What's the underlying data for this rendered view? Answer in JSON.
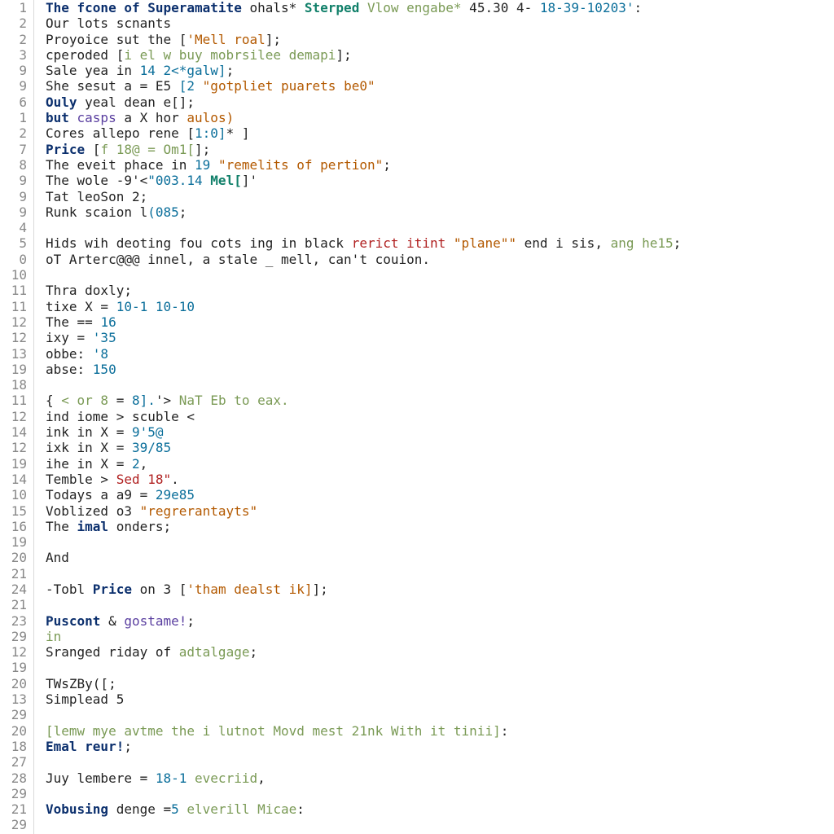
{
  "gutter_numbers": [
    "1",
    "2",
    "2",
    "3",
    "9",
    "9",
    "6",
    "1",
    "2",
    "7",
    "8",
    "9",
    "9",
    "9",
    "4",
    "5",
    "0",
    "10",
    "11",
    "11",
    "12",
    "12",
    "13",
    "19",
    "18",
    "11",
    "12",
    "14",
    "12",
    "19",
    "14",
    "10",
    "15",
    "16",
    "19",
    "20",
    "21",
    "24",
    "21",
    "23",
    "29",
    "12",
    "19",
    "20",
    "13",
    "29",
    "20",
    "18",
    "27",
    "28",
    "29",
    "21",
    "29"
  ],
  "lines": [
    [
      {
        "cls": "kw",
        "t": "The fcone of Superamatite"
      },
      {
        "cls": "pl",
        "t": " ohals* "
      },
      {
        "cls": "ty",
        "t": "Sterped "
      },
      {
        "cls": "com",
        "t": "Vlow engabe*"
      },
      {
        "cls": "pl",
        "t": " 45.30 4- "
      },
      {
        "cls": "num",
        "t": "18-39-10203'"
      },
      {
        "cls": "pl",
        "t": ":"
      }
    ],
    [
      {
        "cls": "pl",
        "t": "Our lots scnants"
      }
    ],
    [
      {
        "cls": "pl",
        "t": "Proyoice sut the ["
      },
      {
        "cls": "str",
        "t": "'Mell roal"
      },
      {
        "cls": "pl",
        "t": "];"
      }
    ],
    [
      {
        "cls": "pl",
        "t": "cperoded ["
      },
      {
        "cls": "com",
        "t": "i el w buy mobrsilee demapi"
      },
      {
        "cls": "pl",
        "t": "];"
      }
    ],
    [
      {
        "cls": "pl",
        "t": "Sale yea in "
      },
      {
        "cls": "num",
        "t": "14 2<*galw]"
      },
      {
        "cls": "pl",
        "t": ";"
      }
    ],
    [
      {
        "cls": "pl",
        "t": "She sesut a = E5 "
      },
      {
        "cls": "num",
        "t": "[2 "
      },
      {
        "cls": "str",
        "t": "\"gotpliet puarets be0\""
      }
    ],
    [
      {
        "cls": "kw",
        "t": "Ouly"
      },
      {
        "cls": "pl",
        "t": " yeal dean e[];"
      }
    ],
    [
      {
        "cls": "kw",
        "t": "but "
      },
      {
        "cls": "fn",
        "t": "casps"
      },
      {
        "cls": "pl",
        "t": " a X hor "
      },
      {
        "cls": "str",
        "t": "aulos)"
      }
    ],
    [
      {
        "cls": "pl",
        "t": "Cores allepo rene ["
      },
      {
        "cls": "num",
        "t": "1:0]"
      },
      {
        "cls": "pl",
        "t": "* ]"
      }
    ],
    [
      {
        "cls": "kw",
        "t": "Price"
      },
      {
        "cls": "pl",
        "t": " ["
      },
      {
        "cls": "com",
        "t": "f 18@ = Om1["
      },
      {
        "cls": "pl",
        "t": "];"
      }
    ],
    [
      {
        "cls": "pl",
        "t": "The eveit phace in "
      },
      {
        "cls": "num",
        "t": "19 "
      },
      {
        "cls": "str",
        "t": "\"remelits of pertion\""
      },
      {
        "cls": "pl",
        "t": ";"
      }
    ],
    [
      {
        "cls": "pl",
        "t": "The wole -9'<"
      },
      {
        "cls": "num",
        "t": "\"003.14 "
      },
      {
        "cls": "ty",
        "t": "Mel["
      },
      {
        "cls": "pl",
        "t": "]'"
      }
    ],
    [
      {
        "cls": "pl",
        "t": "Tat leoSon 2;"
      }
    ],
    [
      {
        "cls": "pl",
        "t": "Runk scaion l"
      },
      {
        "cls": "num",
        "t": "(085"
      },
      {
        "cls": "pl",
        "t": ";"
      }
    ],
    [
      {
        "cls": "pl",
        "t": ""
      }
    ],
    [
      {
        "cls": "pl",
        "t": "Hids wih deoting fou cots ing in black "
      },
      {
        "cls": "err",
        "t": "rerict itint "
      },
      {
        "cls": "str",
        "t": "\"plane\"\""
      },
      {
        "cls": "pl",
        "t": " end i sis, "
      },
      {
        "cls": "com",
        "t": "ang he15"
      },
      {
        "cls": "pl",
        "t": ";"
      }
    ],
    [
      {
        "cls": "pl",
        "t": "oT Arterc@@@ innel, a stale _ mell, can't couion."
      }
    ],
    [
      {
        "cls": "pl",
        "t": ""
      }
    ],
    [
      {
        "cls": "pl",
        "t": "Thra doxly;"
      }
    ],
    [
      {
        "cls": "pl",
        "t": "tixe X = "
      },
      {
        "cls": "num",
        "t": "10-1 10-10"
      }
    ],
    [
      {
        "cls": "pl",
        "t": "The == "
      },
      {
        "cls": "num",
        "t": "16"
      }
    ],
    [
      {
        "cls": "pl",
        "t": "ixy = "
      },
      {
        "cls": "num",
        "t": "'35"
      }
    ],
    [
      {
        "cls": "pl",
        "t": "obbe: "
      },
      {
        "cls": "num",
        "t": "'8"
      }
    ],
    [
      {
        "cls": "pl",
        "t": "abse: "
      },
      {
        "cls": "num",
        "t": "150"
      }
    ],
    [
      {
        "cls": "pl",
        "t": ""
      }
    ],
    [
      {
        "cls": "pl",
        "t": "{ "
      },
      {
        "cls": "com",
        "t": "< or 8"
      },
      {
        "cls": "pl",
        "t": " = "
      },
      {
        "cls": "num",
        "t": "8]."
      },
      {
        "cls": "pl",
        "t": "'> "
      },
      {
        "cls": "com",
        "t": "NaT Eb to eax."
      }
    ],
    [
      {
        "cls": "pl",
        "t": "ind iome > scuble <"
      }
    ],
    [
      {
        "cls": "pl",
        "t": "ink in X = "
      },
      {
        "cls": "num",
        "t": "9'5@"
      }
    ],
    [
      {
        "cls": "pl",
        "t": "ixk in X = "
      },
      {
        "cls": "num",
        "t": "39/85"
      }
    ],
    [
      {
        "cls": "pl",
        "t": "ihe in X = "
      },
      {
        "cls": "num",
        "t": "2"
      },
      {
        "cls": "pl",
        "t": ","
      }
    ],
    [
      {
        "cls": "pl",
        "t": "Temble > "
      },
      {
        "cls": "err",
        "t": "Sed 18\""
      },
      {
        "cls": "pl",
        "t": "."
      }
    ],
    [
      {
        "cls": "pl",
        "t": "Todays a a9 = "
      },
      {
        "cls": "num",
        "t": "29e85"
      }
    ],
    [
      {
        "cls": "pl",
        "t": "Voblized o3 "
      },
      {
        "cls": "str",
        "t": "\"regrerantayts\""
      }
    ],
    [
      {
        "cls": "pl",
        "t": "The "
      },
      {
        "cls": "kw",
        "t": "imal"
      },
      {
        "cls": "pl",
        "t": " onders;"
      }
    ],
    [
      {
        "cls": "pl",
        "t": ""
      }
    ],
    [
      {
        "cls": "pl",
        "t": "And"
      }
    ],
    [
      {
        "cls": "pl",
        "t": ""
      }
    ],
    [
      {
        "cls": "pl",
        "t": "-Tobl "
      },
      {
        "cls": "kw",
        "t": "Price"
      },
      {
        "cls": "pl",
        "t": " on 3 ["
      },
      {
        "cls": "str",
        "t": "'tham dealst ik]"
      },
      {
        "cls": "pl",
        "t": "];"
      }
    ],
    [
      {
        "cls": "pl",
        "t": ""
      }
    ],
    [
      {
        "cls": "kw",
        "t": "Puscont"
      },
      {
        "cls": "pl",
        "t": " & "
      },
      {
        "cls": "fn",
        "t": "gostame!"
      },
      {
        "cls": "pl",
        "t": ";"
      }
    ],
    [
      {
        "cls": "com",
        "t": "in"
      }
    ],
    [
      {
        "cls": "pl",
        "t": "Sranged riday of "
      },
      {
        "cls": "com",
        "t": "adtalgage"
      },
      {
        "cls": "pl",
        "t": ";"
      }
    ],
    [
      {
        "cls": "pl",
        "t": ""
      }
    ],
    [
      {
        "cls": "pl",
        "t": "TWsZBy([;"
      }
    ],
    [
      {
        "cls": "pl",
        "t": "Simplead 5"
      }
    ],
    [
      {
        "cls": "pl",
        "t": ""
      }
    ],
    [
      {
        "cls": "com",
        "t": "[lemw mye avtme the i lutnot Movd mest 21nk With it tinii]"
      },
      {
        "cls": "pl",
        "t": ":"
      }
    ],
    [
      {
        "cls": "kw",
        "t": "Emal reur!"
      },
      {
        "cls": "pl",
        "t": ";"
      }
    ],
    [
      {
        "cls": "pl",
        "t": ""
      }
    ],
    [
      {
        "cls": "pl",
        "t": "Juy lembere = "
      },
      {
        "cls": "num",
        "t": "18-1 "
      },
      {
        "cls": "com",
        "t": "evecriid"
      },
      {
        "cls": "pl",
        "t": ","
      }
    ],
    [
      {
        "cls": "pl",
        "t": ""
      }
    ],
    [
      {
        "cls": "kw",
        "t": "Vobusing "
      },
      {
        "cls": "pl",
        "t": "denge ="
      },
      {
        "cls": "num",
        "t": "5 "
      },
      {
        "cls": "com",
        "t": "elverill Micae"
      },
      {
        "cls": "pl",
        "t": ":"
      }
    ],
    [
      {
        "cls": "pl",
        "t": ""
      }
    ]
  ]
}
